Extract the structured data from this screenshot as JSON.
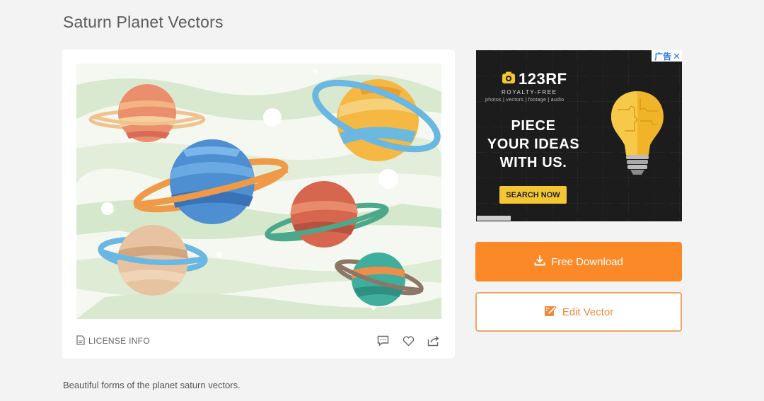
{
  "page": {
    "title": "Saturn Planet Vectors",
    "description": "Beautiful forms of the planet saturn vectors."
  },
  "card": {
    "license_label": "LICENSE INFO",
    "actions": [
      {
        "icon": "comment-icon"
      },
      {
        "icon": "heart-icon"
      },
      {
        "icon": "share-icon"
      }
    ]
  },
  "ad": {
    "tag": "广告",
    "close": "✕",
    "brand": "123RF",
    "tagline": "ROYALTY-FREE",
    "subline": "photos | vectors | footage | audio",
    "headline_1": "PIECE",
    "headline_2": "YOUR IDEAS",
    "headline_3": "WITH US.",
    "cta": "SEARCH NOW",
    "cta_color": "#f4c633"
  },
  "actions": {
    "download_label": "Free Download",
    "edit_label": "Edit Vector",
    "accent_color": "#fb8928"
  }
}
